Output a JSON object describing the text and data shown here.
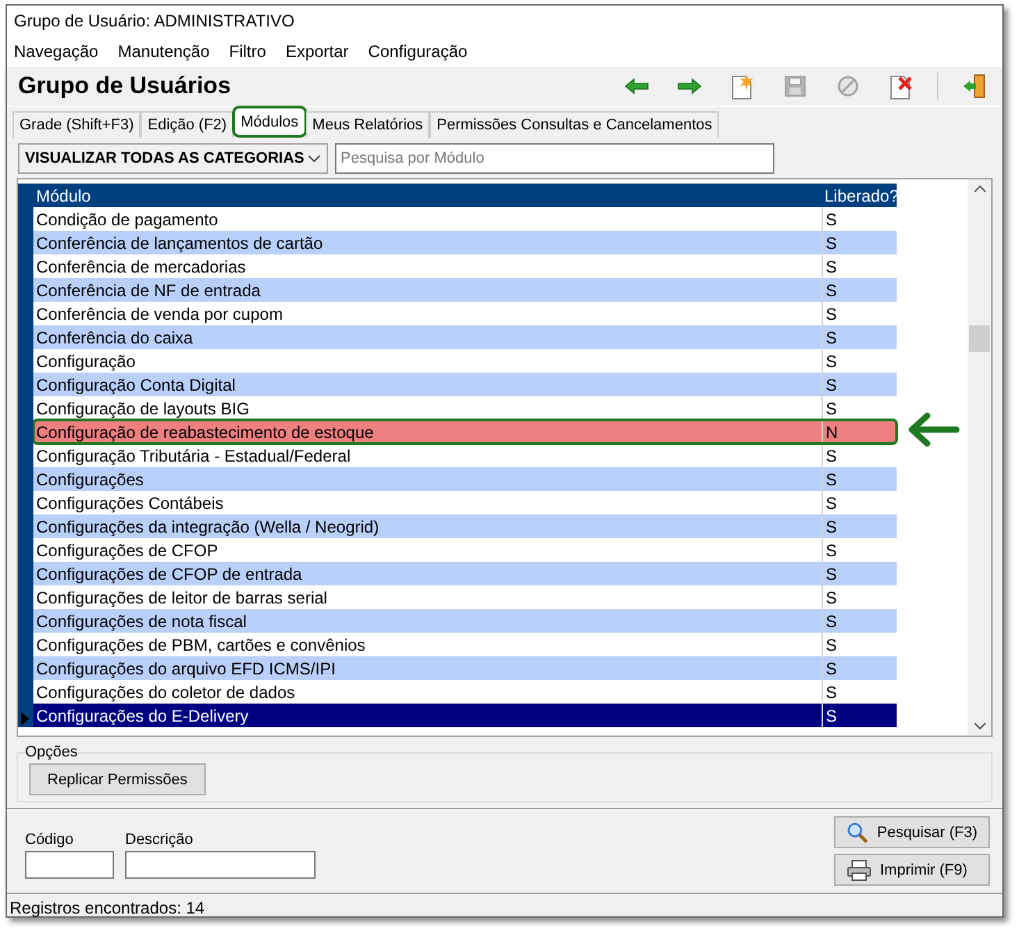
{
  "window": {
    "title": "Grupo de Usuário: ADMINISTRATIVO"
  },
  "menu": [
    "Navegação",
    "Manutenção",
    "Filtro",
    "Exportar",
    "Configuração"
  ],
  "header": {
    "title": "Grupo de Usuários"
  },
  "toolbar": [
    {
      "kind": "back",
      "disabled": false
    },
    {
      "kind": "forward",
      "disabled": false
    },
    {
      "kind": "new",
      "disabled": false
    },
    {
      "kind": "save",
      "disabled": true
    },
    {
      "kind": "cancel",
      "disabled": true
    },
    {
      "kind": "delete",
      "disabled": false
    },
    {
      "kind": "exit",
      "disabled": false
    }
  ],
  "tabs": [
    {
      "label": "Grade (Shift+F3)",
      "selected": false,
      "callout": false
    },
    {
      "label": "Edição (F2)",
      "selected": false,
      "callout": false
    },
    {
      "label": "Módulos",
      "selected": true,
      "callout": true
    },
    {
      "label": "Meus Relatórios",
      "selected": false,
      "callout": false
    },
    {
      "label": "Permissões Consultas e Cancelamentos",
      "selected": false,
      "callout": false
    }
  ],
  "filter": {
    "category": "VISUALIZAR TODAS AS CATEGORIAS",
    "placeholder": "Pesquisa por Módulo"
  },
  "table": {
    "columns": [
      "Módulo",
      "Liberado?"
    ],
    "rows": [
      {
        "module": "Condição de pagamento",
        "released": "S",
        "selected": false,
        "callout": false
      },
      {
        "module": "Conferência de lançamentos de cartão",
        "released": "S",
        "selected": false,
        "callout": false
      },
      {
        "module": "Conferência de mercadorias",
        "released": "S",
        "selected": false,
        "callout": false
      },
      {
        "module": "Conferência de NF de entrada",
        "released": "S",
        "selected": false,
        "callout": false
      },
      {
        "module": "Conferência de venda por cupom",
        "released": "S",
        "selected": false,
        "callout": false
      },
      {
        "module": "Conferência do caixa",
        "released": "S",
        "selected": false,
        "callout": false
      },
      {
        "module": "Configuração",
        "released": "S",
        "selected": false,
        "callout": false
      },
      {
        "module": "Configuração Conta Digital",
        "released": "S",
        "selected": false,
        "callout": false
      },
      {
        "module": "Configuração de layouts BIG",
        "released": "S",
        "selected": false,
        "callout": false
      },
      {
        "module": "Configuração de reabastecimento de estoque",
        "released": "N",
        "selected": false,
        "callout": true
      },
      {
        "module": "Configuração Tributária - Estadual/Federal",
        "released": "S",
        "selected": false,
        "callout": false
      },
      {
        "module": "Configurações",
        "released": "S",
        "selected": false,
        "callout": false
      },
      {
        "module": "Configurações Contábeis",
        "released": "S",
        "selected": false,
        "callout": false
      },
      {
        "module": "Configurações da integração (Wella / Neogrid)",
        "released": "S",
        "selected": false,
        "callout": false
      },
      {
        "module": "Configurações de CFOP",
        "released": "S",
        "selected": false,
        "callout": false
      },
      {
        "module": "Configurações de CFOP de entrada",
        "released": "S",
        "selected": false,
        "callout": false
      },
      {
        "module": "Configurações de leitor de barras serial",
        "released": "S",
        "selected": false,
        "callout": false
      },
      {
        "module": "Configurações de nota fiscal",
        "released": "S",
        "selected": false,
        "callout": false
      },
      {
        "module": "Configurações de PBM, cartões e convênios",
        "released": "S",
        "selected": false,
        "callout": false
      },
      {
        "module": "Configurações do arquivo EFD ICMS/IPI",
        "released": "S",
        "selected": false,
        "callout": false
      },
      {
        "module": "Configurações do coletor de dados",
        "released": "S",
        "selected": false,
        "callout": false
      },
      {
        "module": "Configurações do E-Delivery",
        "released": "S",
        "selected": true,
        "callout": false
      }
    ]
  },
  "options": {
    "title": "Opções",
    "button": "Replicar Permissões"
  },
  "search": {
    "fields": [
      {
        "label": "Código"
      },
      {
        "label": "Descrição"
      }
    ],
    "buttons": [
      {
        "kind": "search",
        "label": "Pesquisar (F3)"
      },
      {
        "kind": "print",
        "label": "Imprimir (F9)"
      }
    ]
  },
  "status_bar": "Registros encontrados: 14"
}
